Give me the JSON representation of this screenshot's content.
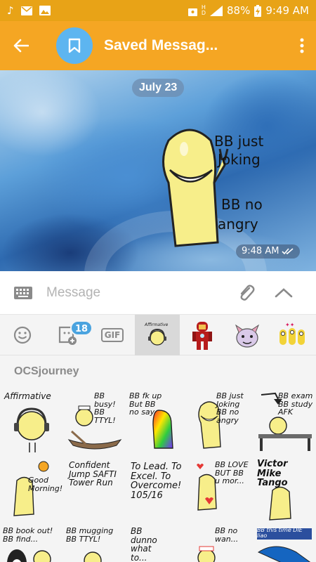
{
  "status_bar": {
    "battery": "88%",
    "time": "9:49 AM"
  },
  "app_bar": {
    "title": "Saved Messag..."
  },
  "chat": {
    "date_label": "July 23",
    "message": {
      "sticker_text_1": "BB just Joking",
      "sticker_text_2": "BB no angry",
      "time": "9:48 AM"
    }
  },
  "input": {
    "placeholder": "Message"
  },
  "sticker_tabs": {
    "badge_count": "18",
    "gif_label": "GIF",
    "active_tab_text": "Affirmative"
  },
  "sticker_panel": {
    "pack_name": "OCSjourney",
    "stickers": [
      {
        "text": "Affirmative"
      },
      {
        "text": "BB busy! BB TTYL!"
      },
      {
        "text": "BB fk up  But BB no say"
      },
      {
        "text": "BB just Joking  BB no angry"
      },
      {
        "text": "BB exam  BB study  AFK"
      },
      {
        "text": "Good Morning!"
      },
      {
        "text": "Confident Jump  SAFTI Tower Run"
      },
      {
        "text": "To Lead. To Excel. To Overcome!  105/16"
      },
      {
        "text": "BB LOVE  BUT  BB u mor..."
      },
      {
        "text": "Victor Mike Tango"
      },
      {
        "text": "BB book out!  BB find..."
      },
      {
        "text": "BB mugging  BB TTYL!"
      },
      {
        "text": "BB dunno what to..."
      },
      {
        "text": "BB no wan..."
      },
      {
        "text": "BB this time DIE liao"
      }
    ]
  },
  "colors": {
    "status_bar": "#e8a317",
    "app_bar": "#f5a623",
    "avatar": "#5db5f0",
    "badge": "#4aa3df"
  }
}
